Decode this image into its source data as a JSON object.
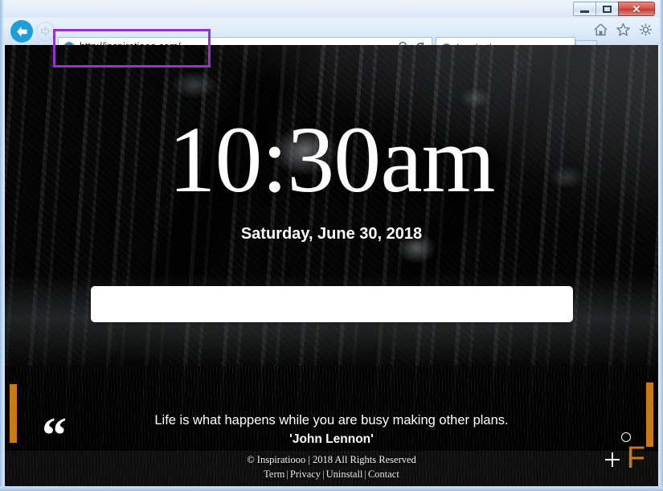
{
  "window": {
    "controls": {
      "minimize": "–",
      "maximize": "□",
      "close": "✕"
    }
  },
  "browser": {
    "back_label": "Back",
    "forward_label": "Forward",
    "address": {
      "url": "http://inspiratiooo.com/",
      "favicon": "ie-logo-icon",
      "search_icon": "magnifier-icon",
      "dropdown_icon": "chevron-down-icon",
      "refresh_icon": "refresh-icon"
    },
    "tab": {
      "title": "Inspiratiooo",
      "favicon": "ie-logo-icon",
      "close": "×"
    },
    "new_tab_label": "",
    "toolbar_icons": [
      "home-icon",
      "favorites-star-icon",
      "settings-gear-icon"
    ],
    "highlight_color": "#9b30d0"
  },
  "page": {
    "clock": {
      "time": "10:30",
      "meridiem": "am",
      "date": "Saturday, June 30, 2018"
    },
    "search": {
      "value": "",
      "placeholder": ""
    },
    "quote": {
      "mark": "“",
      "text": "Life is what happens while you are busy making other plans.",
      "author": "'John Lennon'"
    },
    "footer": {
      "copyright": "© Inspiratiooo | 2018 All Rights Reserved",
      "links": [
        "Term",
        "Privacy",
        "Uninstall",
        "Contact"
      ],
      "separator": "|"
    },
    "widgets": {
      "circle": "circle-outline-icon",
      "plus": "plus-icon",
      "letter": "F"
    },
    "accent_color": "#c97a16"
  }
}
